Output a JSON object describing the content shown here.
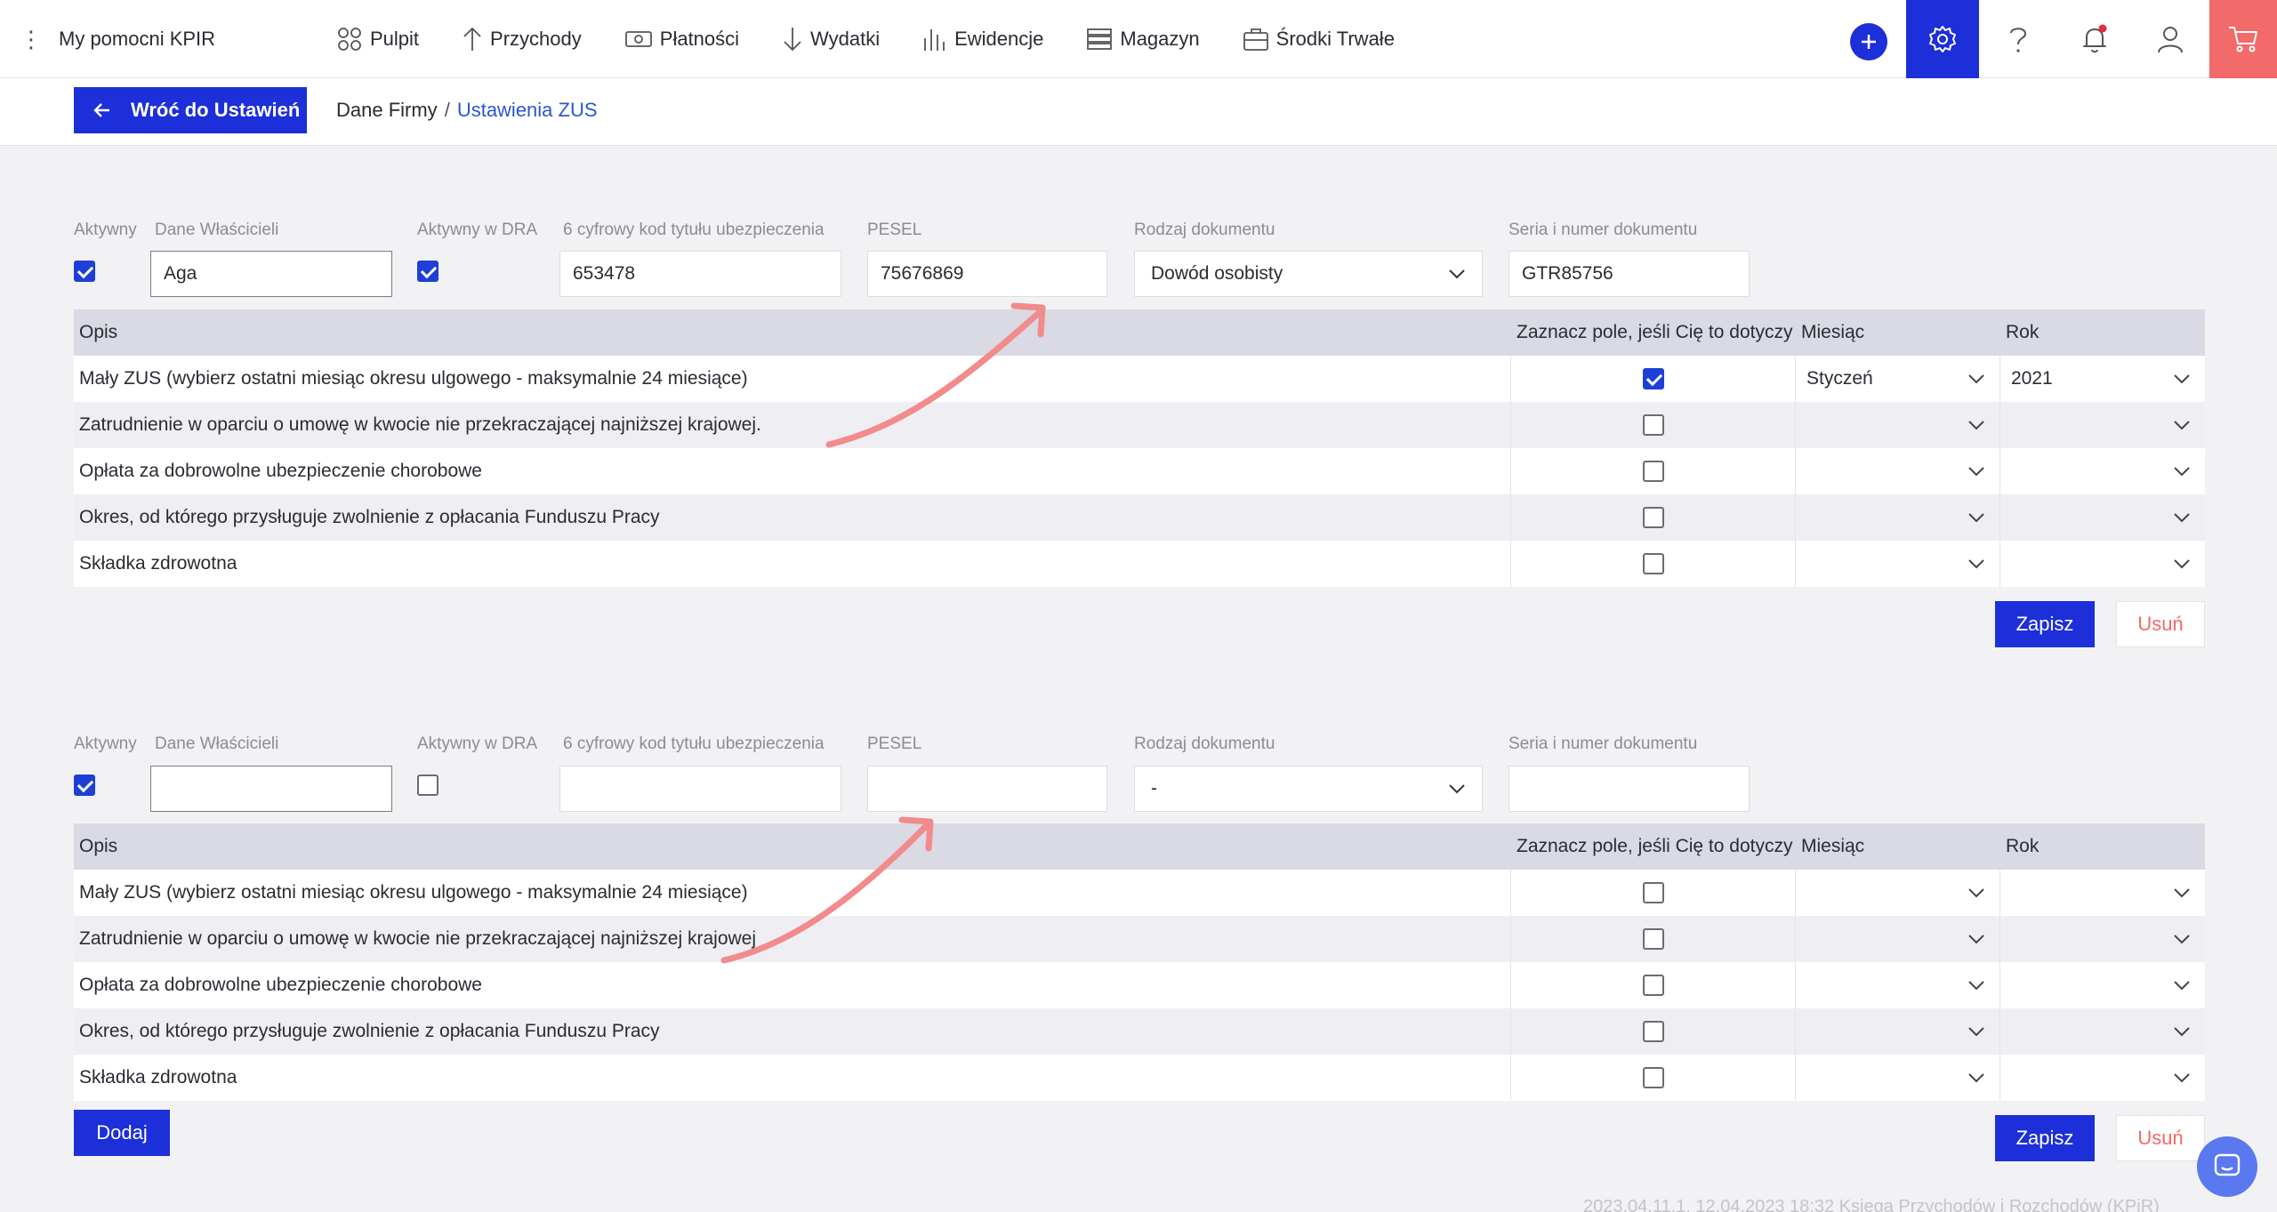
{
  "nav": {
    "brand": "My pomocni KPIR",
    "items": [
      {
        "label": "Pulpit",
        "icon": "dashboard-icon"
      },
      {
        "label": "Przychody",
        "icon": "arrow-up-icon"
      },
      {
        "label": "Płatności",
        "icon": "payment-icon"
      },
      {
        "label": "Wydatki",
        "icon": "arrow-down-icon"
      },
      {
        "label": "Ewidencje",
        "icon": "chart-bars-icon"
      },
      {
        "label": "Magazyn",
        "icon": "warehouse-icon"
      },
      {
        "label": "Środki Trwałe",
        "icon": "briefcase-icon"
      }
    ],
    "accent": "#1d2fd8",
    "cart_color": "#f26a6a"
  },
  "subbar": {
    "back_label": "Wróć do Ustawień",
    "crumb_parent": "Dane Firmy",
    "crumb_sep": "/",
    "crumb_current": "Ustawienia ZUS"
  },
  "labels": {
    "active": "Aktywny",
    "owner": "Dane Właścicieli",
    "active_dra": "Aktywny w DRA",
    "code": "6 cyfrowy kod tytułu ubezpieczenia",
    "pesel": "PESEL",
    "doc_type": "Rodzaj dokumentu",
    "doc_number": "Seria i numer dokumentu",
    "th_desc": "Opis",
    "th_check": "Zaznacz pole, jeśli Cię to dotyczy",
    "th_month": "Miesiąc",
    "th_year": "Rok",
    "save": "Zapisz",
    "delete": "Usuń",
    "add": "Dodaj"
  },
  "sections": [
    {
      "active": true,
      "owner": "Aga",
      "active_dra": true,
      "code": "653478",
      "pesel": "75676869",
      "doc_type": "Dowód osobisty",
      "doc_number": "GTR85756",
      "rows": [
        {
          "desc": "Mały ZUS (wybierz ostatni miesiąc okresu ulgowego - maksymalnie 24 miesiące)",
          "checked": true,
          "month": "Styczeń",
          "year": "2021"
        },
        {
          "desc": "Zatrudnienie w oparciu o umowę w kwocie nie przekraczającej najniższej krajowej.",
          "checked": false,
          "month": "",
          "year": ""
        },
        {
          "desc": "Opłata za dobrowolne ubezpieczenie chorobowe",
          "checked": false,
          "month": "",
          "year": ""
        },
        {
          "desc": "Okres, od którego przysługuje zwolnienie z opłacania Funduszu Pracy",
          "checked": false,
          "month": "",
          "year": ""
        },
        {
          "desc": "Składka zdrowotna",
          "checked": false,
          "month": "",
          "year": ""
        }
      ]
    },
    {
      "active": true,
      "owner": "",
      "active_dra": false,
      "code": "",
      "pesel": "",
      "doc_type": "-",
      "doc_number": "",
      "rows": [
        {
          "desc": "Mały ZUS (wybierz ostatni miesiąc okresu ulgowego - maksymalnie 24 miesiące)",
          "checked": false,
          "month": "",
          "year": ""
        },
        {
          "desc": "Zatrudnienie w oparciu o umowę w kwocie nie przekraczającej najniższej krajowej",
          "checked": false,
          "month": "",
          "year": ""
        },
        {
          "desc": "Opłata za dobrowolne ubezpieczenie chorobowe",
          "checked": false,
          "month": "",
          "year": ""
        },
        {
          "desc": "Okres, od którego przysługuje zwolnienie z opłacania Funduszu Pracy",
          "checked": false,
          "month": "",
          "year": ""
        },
        {
          "desc": "Składka zdrowotna",
          "checked": false,
          "month": "",
          "year": ""
        }
      ]
    }
  ],
  "footer": "2023.04.11.1, 12.04.2023 18:32 Księga Przychodów i Rozchodów (KPiR)"
}
